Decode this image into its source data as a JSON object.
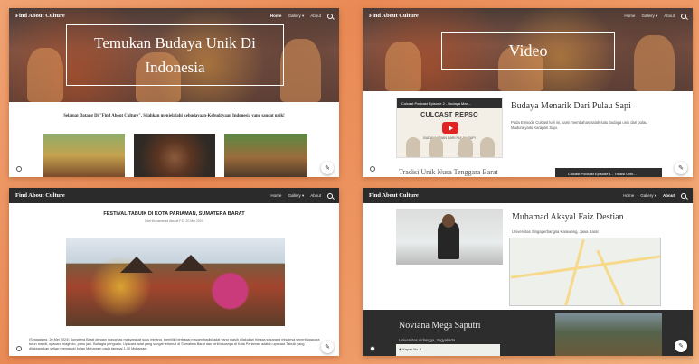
{
  "site": {
    "brand": "Find About Culture",
    "nav": [
      "Home",
      "Gallery",
      "About"
    ],
    "nav_dropdown": "▾"
  },
  "panel1": {
    "hero_title": "Temukan Budaya Unik Di Indonesia",
    "welcome": "Selamat Datang Di \"Find About Culture\", Silahkan menjelajahi kebudayaan-Kebudayaan Indonesia yang sangat unik!",
    "active_nav": "Home"
  },
  "panel2": {
    "hero_title": "Video",
    "video_channel": "Culcast Podcast Episode 2 - Budaya Man...",
    "video_cast": "CULCAST REPSO",
    "video_subtitle": "BUDAYA ASIAN DARI PULAU SAPI",
    "video_title": "Budaya Menarik Dari Pulau Sapi",
    "video_desc": "Pada Episode Culcast kali ini, kami membahas salah satu budaya unik dari pulau Madura yaitu Karapan Sapi.",
    "next_title": "Tradisi Unik Nusa Tenggara Barat",
    "next_strip": "Culcast Podcast Episode 1 - Tradisi Unik..."
  },
  "panel3": {
    "article_title": "FESTIVAL TABUIK DI KOTA PARIAMAN, SUMATERA BARAT",
    "article_meta": "Dari Muhammad Aksyal F.D. 20 Mei 2024",
    "article_text": "(Singgalang, 20 Mei 2024) Sumatera Barat dengan mayoritas masyarakat suku minang, memiliki berbagai macam tradisi adat yang masih dilakukan hingga sekarang misalnya seperti upacara turun mandi, upacara magholo, panu jadi. Bahagia penguatu. Upacara adat yang sangat terkenal di Sumatera Barat dan terkhususnya di Kota Pariaman adalah upacara Tabuik yang dilaksanakan setiap memasuki bulan Muharram pada tanggal 1-10 Muharram."
  },
  "panel4": {
    "active_nav": "About",
    "person1_name": "Muhamad Aksyal Faiz Destian",
    "person1_univ": "Universitas Singaperbangsa Karawang, Jawa Barat",
    "person2_name": "Noviana Mega Saputri",
    "person2_univ": "Universitas Airlangga, Yogyakarta",
    "map_label": "Kapas No. 1"
  },
  "icons": {
    "edit": "✎",
    "circle": "○"
  },
  "colors": {
    "background": "#ee955f",
    "dark_bar": "#2b2b2b",
    "play": "#e02424"
  }
}
